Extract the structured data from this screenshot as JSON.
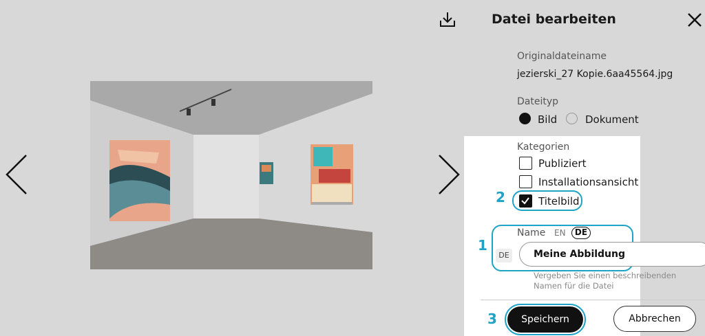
{
  "viewer": {
    "prev_icon": "chevron-left-icon",
    "next_icon": "chevron-right-icon",
    "download_icon": "download-icon"
  },
  "panel": {
    "title": "Datei bearbeiten",
    "close_icon": "close-icon",
    "original_filename_label": "Originaldateiname",
    "original_filename": "jezierski_27 Kopie.6aa45564.jpg",
    "filetype_label": "Dateityp",
    "filetype_options": [
      {
        "label": "Bild",
        "selected": true
      },
      {
        "label": "Dokument",
        "selected": false
      }
    ],
    "categories_label": "Kategorien",
    "categories": [
      {
        "label": "Publiziert",
        "checked": false
      },
      {
        "label": "Installationsansicht",
        "checked": false
      },
      {
        "label": "Titelbild",
        "checked": true
      }
    ],
    "name_label": "Name",
    "lang_en": "EN",
    "lang_de": "DE",
    "name_field_lang": "DE",
    "name_value": "Meine Abbildung",
    "name_hint": "Vergeben Sie einen beschreibenden Namen für die Datei",
    "save_label": "Speichern",
    "cancel_label": "Abbrechen"
  },
  "annotations": {
    "step_1": "1",
    "step_2": "2",
    "step_3": "3",
    "color": "#1ea3c7"
  }
}
